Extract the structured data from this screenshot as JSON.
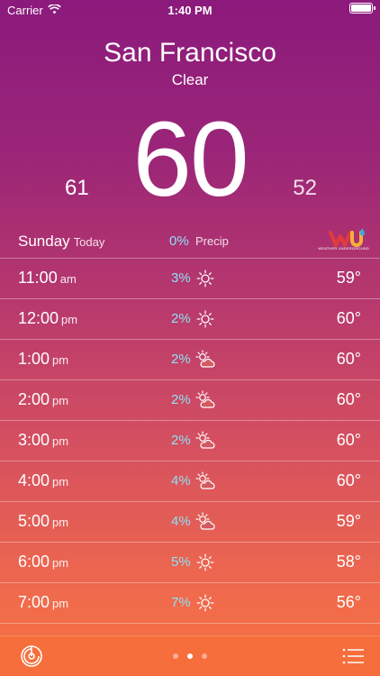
{
  "status": {
    "carrier": "Carrier",
    "time": "1:40 PM"
  },
  "weather": {
    "city": "San Francisco",
    "condition": "Clear",
    "current_temp": "60",
    "high": "61",
    "low": "52"
  },
  "day": {
    "name": "Sunday",
    "label": "Today",
    "precip_pct": "0%",
    "precip_label": "Precip",
    "logo_text": "WEATHER UNDERGROUND"
  },
  "hours": [
    {
      "time": "11:00",
      "ampm": "am",
      "precip": "3%",
      "icon": "sun-icon",
      "temp": "59°"
    },
    {
      "time": "12:00",
      "ampm": "pm",
      "precip": "2%",
      "icon": "sun-icon",
      "temp": "60°"
    },
    {
      "time": "1:00",
      "ampm": "pm",
      "precip": "2%",
      "icon": "partly-cloudy-icon",
      "temp": "60°"
    },
    {
      "time": "2:00",
      "ampm": "pm",
      "precip": "2%",
      "icon": "partly-cloudy-icon",
      "temp": "60°"
    },
    {
      "time": "3:00",
      "ampm": "pm",
      "precip": "2%",
      "icon": "partly-cloudy-icon",
      "temp": "60°"
    },
    {
      "time": "4:00",
      "ampm": "pm",
      "precip": "4%",
      "icon": "partly-cloudy-icon",
      "temp": "60°"
    },
    {
      "time": "5:00",
      "ampm": "pm",
      "precip": "4%",
      "icon": "partly-cloudy-icon",
      "temp": "59°"
    },
    {
      "time": "6:00",
      "ampm": "pm",
      "precip": "5%",
      "icon": "sun-icon",
      "temp": "58°"
    },
    {
      "time": "7:00",
      "ampm": "pm",
      "precip": "7%",
      "icon": "sun-icon",
      "temp": "56°"
    }
  ],
  "colors": {
    "precip_accent": "#8fe0f5"
  },
  "pager": {
    "count": 3,
    "active_index": 1
  }
}
